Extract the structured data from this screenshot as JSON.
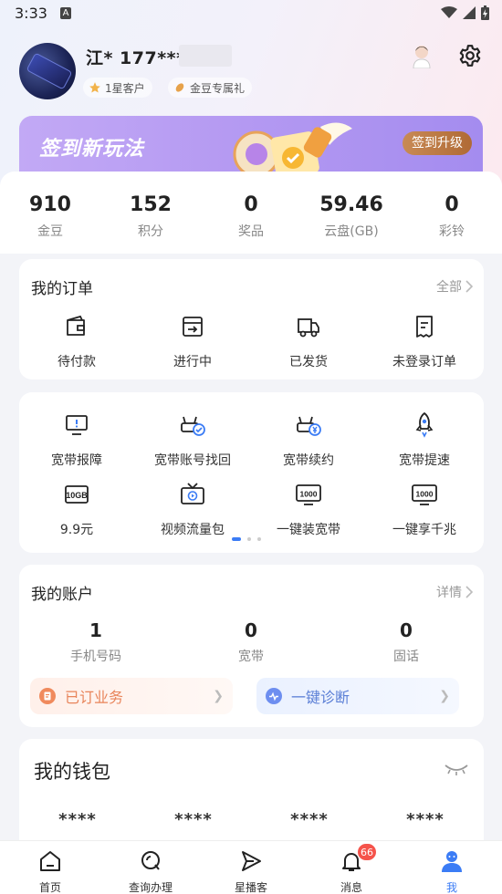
{
  "status_bar": {
    "time": "3:33",
    "ime_indicator": "A"
  },
  "profile": {
    "username": "江* 177****",
    "badge_level": "1星客户",
    "badge_gift": "金豆专属礼"
  },
  "banner": {
    "title": "签到新玩法",
    "button": "签到升级"
  },
  "stats": [
    {
      "value": "910",
      "label": "金豆"
    },
    {
      "value": "152",
      "label": "积分"
    },
    {
      "value": "0",
      "label": "奖品"
    },
    {
      "value": "59.46",
      "label": "云盘(GB)"
    },
    {
      "value": "0",
      "label": "彩铃"
    }
  ],
  "orders": {
    "title": "我的订单",
    "more": "全部",
    "items": [
      {
        "label": "待付款",
        "icon": "wallet-icon"
      },
      {
        "label": "进行中",
        "icon": "inbox-arrow-icon"
      },
      {
        "label": "已发货",
        "icon": "truck-icon"
      },
      {
        "label": "未登录订单",
        "icon": "receipt-icon"
      }
    ]
  },
  "services": {
    "items": [
      {
        "label": "宽带报障",
        "icon": "monitor-alert-icon"
      },
      {
        "label": "宽带账号找回",
        "icon": "router-check-icon"
      },
      {
        "label": "宽带续约",
        "icon": "router-yen-icon"
      },
      {
        "label": "宽带提速",
        "icon": "rocket-icon"
      },
      {
        "label": "9.9元",
        "icon": "data-10gb-icon",
        "icon_text": "10GB"
      },
      {
        "label": "视频流量包",
        "icon": "tv-play-icon"
      },
      {
        "label": "一键装宽带",
        "icon": "broadband-1000-icon",
        "icon_text": "1000"
      },
      {
        "label": "一键享千兆",
        "icon": "gigabit-1000-icon",
        "icon_text": "1000"
      }
    ],
    "page_index": 1,
    "page_count": 3
  },
  "account": {
    "title": "我的账户",
    "more": "详情",
    "stats": [
      {
        "value": "1",
        "label": "手机号码"
      },
      {
        "value": "0",
        "label": "宽带"
      },
      {
        "value": "0",
        "label": "固话"
      }
    ],
    "subscribed": "已订业务",
    "diagnose": "一键诊断"
  },
  "wallet": {
    "title": "我的钱包",
    "values": [
      "****",
      "****",
      "****",
      "****"
    ]
  },
  "nav": [
    {
      "label": "首页",
      "icon": "home-icon"
    },
    {
      "label": "查询办理",
      "icon": "search-icon"
    },
    {
      "label": "星播客",
      "icon": "send-icon"
    },
    {
      "label": "消息",
      "icon": "bell-icon",
      "badge": "66"
    },
    {
      "label": "我",
      "icon": "user-icon"
    }
  ],
  "colors": {
    "accent": "#3b7cf5",
    "banner": "#b59af2",
    "badge": "#f5534b"
  }
}
